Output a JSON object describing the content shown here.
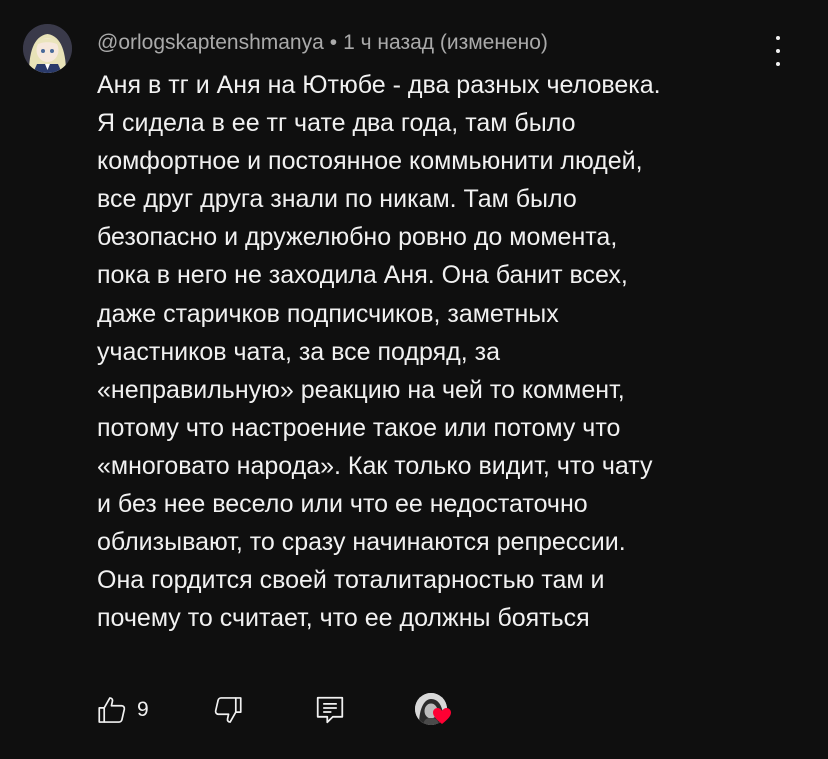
{
  "comment": {
    "author": "@orlogskaptenshmanya",
    "separator": "•",
    "timestamp": "1 ч назад (изменено)",
    "lines": [
      "Аня в тг и Аня на Ютюбе - два разных человека.",
      "Я сидела в ее тг чате два года, там было",
      "комфортное и постоянное коммьюнити людей,",
      "все друг друга знали по никам. Там было",
      "безопасно и дружелюбно ровно до момента,",
      "пока в него не заходила Аня. Она банит всех,",
      "даже старичков подписчиков, заметных",
      "участников чата, за все подряд, за",
      "«неправильную» реакцию на чей то коммент,",
      "потому что настроение такое или потому что",
      "«многовато народа». Как только видит, что чату",
      "и без нее весело или что ее недостаточно",
      "облизывают, то сразу начинаются репрессии.",
      "Она гордится своей тоталитарностью там и",
      "почему то считает, что ее должны бояться"
    ],
    "like_count": "9"
  },
  "icons": {
    "menu": "more-vert-icon",
    "like": "thumb-up-icon",
    "dislike": "thumb-down-icon",
    "reply": "reply-icon",
    "heart": "heart-icon"
  },
  "colors": {
    "background": "#0f0f0f",
    "text": "#f1f1f1",
    "meta_text": "#aaaaaa",
    "heart": "#ff0033"
  }
}
